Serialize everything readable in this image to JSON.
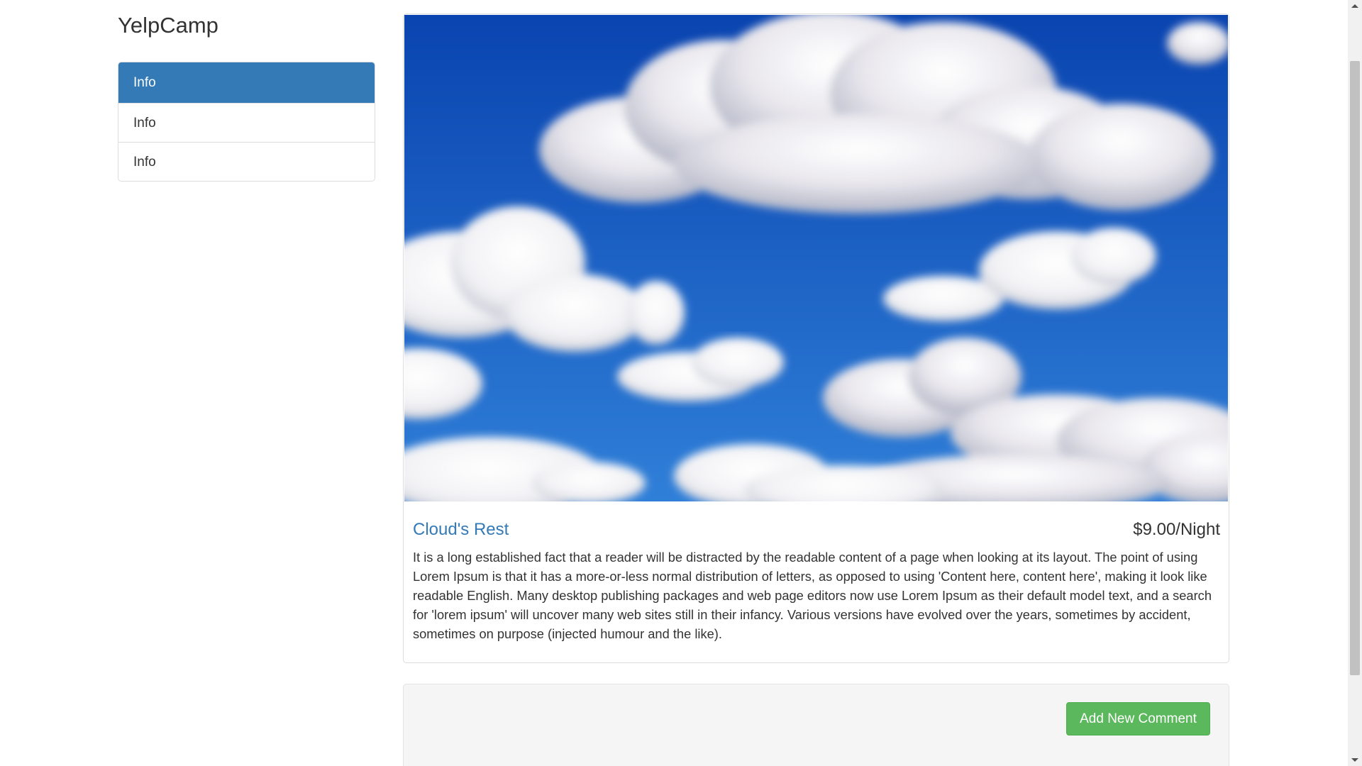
{
  "brand": {
    "title": "YelpCamp"
  },
  "sidebar": {
    "items": [
      {
        "label": "Info",
        "active": true
      },
      {
        "label": "Info",
        "active": false
      },
      {
        "label": "Info",
        "active": false
      }
    ]
  },
  "campground": {
    "image_alt": "Clouds in a blue sky",
    "name": "Cloud's Rest",
    "price": "$9.00/Night",
    "description": "It is a long established fact that a reader will be distracted by the readable content of a page when looking at its layout. The point of using Lorem Ipsum is that it has a more-or-less normal distribution of letters, as opposed to using 'Content here, content here', making it look like readable English. Many desktop publishing packages and web page editors now use Lorem Ipsum as their default model text, and a search for 'lorem ipsum' will uncover many web sites still in their infancy. Various versions have evolved over the years, sometimes by accident, sometimes on purpose (injected humour and the like)."
  },
  "comments": {
    "add_button_label": "Add New Comment"
  },
  "colors": {
    "primary": "#337ab7",
    "success": "#5cb85c",
    "sky_top": "#0a44b0",
    "sky_bottom": "#2f7fd8"
  },
  "icons": {
    "scroll_up": "arrow-up-icon",
    "scroll_down": "arrow-down-icon"
  }
}
